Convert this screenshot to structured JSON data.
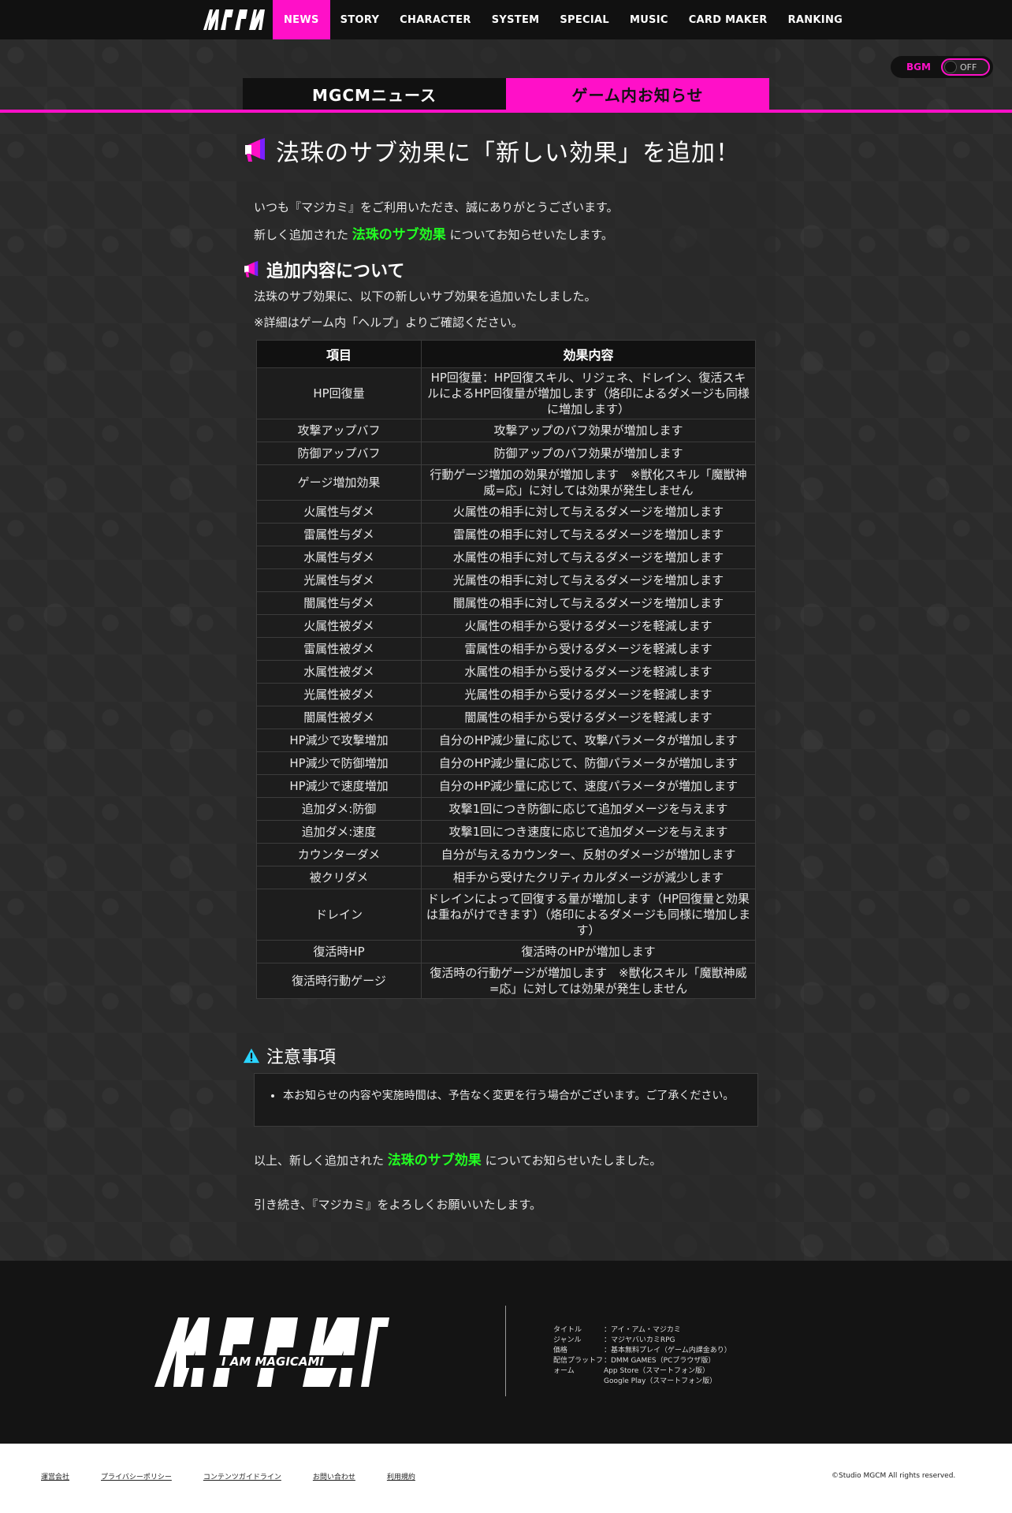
{
  "nav": {
    "logo_text": "IAMMAGICAMI",
    "items": [
      "NEWS",
      "STORY",
      "CHARACTER",
      "SYSTEM",
      "SPECIAL",
      "MUSIC",
      "CARD MAKER",
      "RANKING"
    ],
    "active": "NEWS"
  },
  "bgm": {
    "label": "BGM",
    "state": "OFF"
  },
  "tabs": {
    "news": "MGCMニュース",
    "game": "ゲーム内お知らせ"
  },
  "article": {
    "title": "法珠のサブ効果に「新しい効果」を追加！",
    "intro1": "いつも『マジカミ』をご利用いただき、誠にありがとうございます。",
    "intro2_pre": "新しく追加された",
    "intro2_hl": "法珠のサブ効果",
    "intro2_post": "についてお知らせいたします。",
    "section1_title": "追加内容について",
    "section1_p1": "法珠のサブ効果に、以下の新しいサブ効果を追加いたしました。",
    "section1_p2": "※詳細はゲーム内「ヘルプ」よりご確認ください。",
    "table_head": [
      "項目",
      "効果内容"
    ],
    "rows": [
      [
        "HP回復量",
        "HP回復量：HP回復スキル、リジェネ、ドレイン、復活スキルによるHP回復量が増加します（烙印によるダメージも同様に増加します）"
      ],
      [
        "攻撃アップバフ",
        "攻撃アップのバフ効果が増加します"
      ],
      [
        "防御アップバフ",
        "防御アップのバフ効果が増加します"
      ],
      [
        "ゲージ増加効果",
        "行動ゲージ増加の効果が増加します　※獣化スキル「魔獣神威=応」に対しては効果が発生しません"
      ],
      [
        "火属性与ダメ",
        "火属性の相手に対して与えるダメージを増加します"
      ],
      [
        "雷属性与ダメ",
        "雷属性の相手に対して与えるダメージを増加します"
      ],
      [
        "水属性与ダメ",
        "水属性の相手に対して与えるダメージを増加します"
      ],
      [
        "光属性与ダメ",
        "光属性の相手に対して与えるダメージを増加します"
      ],
      [
        "闇属性与ダメ",
        "闇属性の相手に対して与えるダメージを増加します"
      ],
      [
        "火属性被ダメ",
        "火属性の相手から受けるダメージを軽減します"
      ],
      [
        "雷属性被ダメ",
        "雷属性の相手から受けるダメージを軽減します"
      ],
      [
        "水属性被ダメ",
        "水属性の相手から受けるダメージを軽減します"
      ],
      [
        "光属性被ダメ",
        "光属性の相手から受けるダメージを軽減します"
      ],
      [
        "闇属性被ダメ",
        "闇属性の相手から受けるダメージを軽減します"
      ],
      [
        "HP減少で攻撃増加",
        "自分のHP減少量に応じて、攻撃パラメータが増加します"
      ],
      [
        "HP減少で防御増加",
        "自分のHP減少量に応じて、防御パラメータが増加します"
      ],
      [
        "HP減少で速度増加",
        "自分のHP減少量に応じて、速度パラメータが増加します"
      ],
      [
        "追加ダメ:防御",
        "攻撃1回につき防御に応じて追加ダメージを与えます"
      ],
      [
        "追加ダメ:速度",
        "攻撃1回につき速度に応じて追加ダメージを与えます"
      ],
      [
        "カウンターダメ",
        "自分が与えるカウンター、反射のダメージが増加します"
      ],
      [
        "被クリダメ",
        "相手から受けたクリティカルダメージが減少します"
      ],
      [
        "ドレイン",
        "ドレインによって回復する量が増加します（HP回復量と効果は重ねがけできます）（烙印によるダメージも同様に増加します）"
      ],
      [
        "復活時HP",
        "復活時のHPが増加します"
      ],
      [
        "復活時行動ゲージ",
        "復活時の行動ゲージが増加します　※獣化スキル「魔獣神威=応」に対しては効果が発生しません"
      ]
    ],
    "section2_title": "注意事項",
    "notice": "本お知らせの内容や実施時間は、予告なく変更を行う場合がございます。ご了承ください。",
    "outro1_pre": "以上、新しく追加された",
    "outro1_hl": "法珠のサブ効果",
    "outro1_post": "についてお知らせいたしました。",
    "outro2": "引き続き、『マジカミ』をよろしくお願いいたします。"
  },
  "footer": {
    "logo_sub": "I AM MAGICAMI",
    "info": [
      [
        "タイトル",
        "：アイ・アム・マジカミ"
      ],
      [
        "ジャンル",
        "：マジヤバいカミRPG"
      ],
      [
        "価格",
        "：基本無料プレイ（ゲーム内課金あり）"
      ],
      [
        "配信プラットフ",
        "：DMM GAMES（PCブラウザ版）"
      ],
      [
        "ォーム",
        "App Store（スマートフォン版）"
      ],
      [
        "",
        "Google Play（スマートフォン版）"
      ]
    ],
    "links": [
      "運営会社",
      "プライバシーポリシー",
      "コンテンツガイドライン",
      "お問い合わせ",
      "利用規約"
    ],
    "copyright": "©Studio MGCM All rights reserved."
  },
  "colors": {
    "accent": "#ff10c8",
    "highlight": "#22ff22",
    "notice_icon": "#2ad4ff"
  }
}
